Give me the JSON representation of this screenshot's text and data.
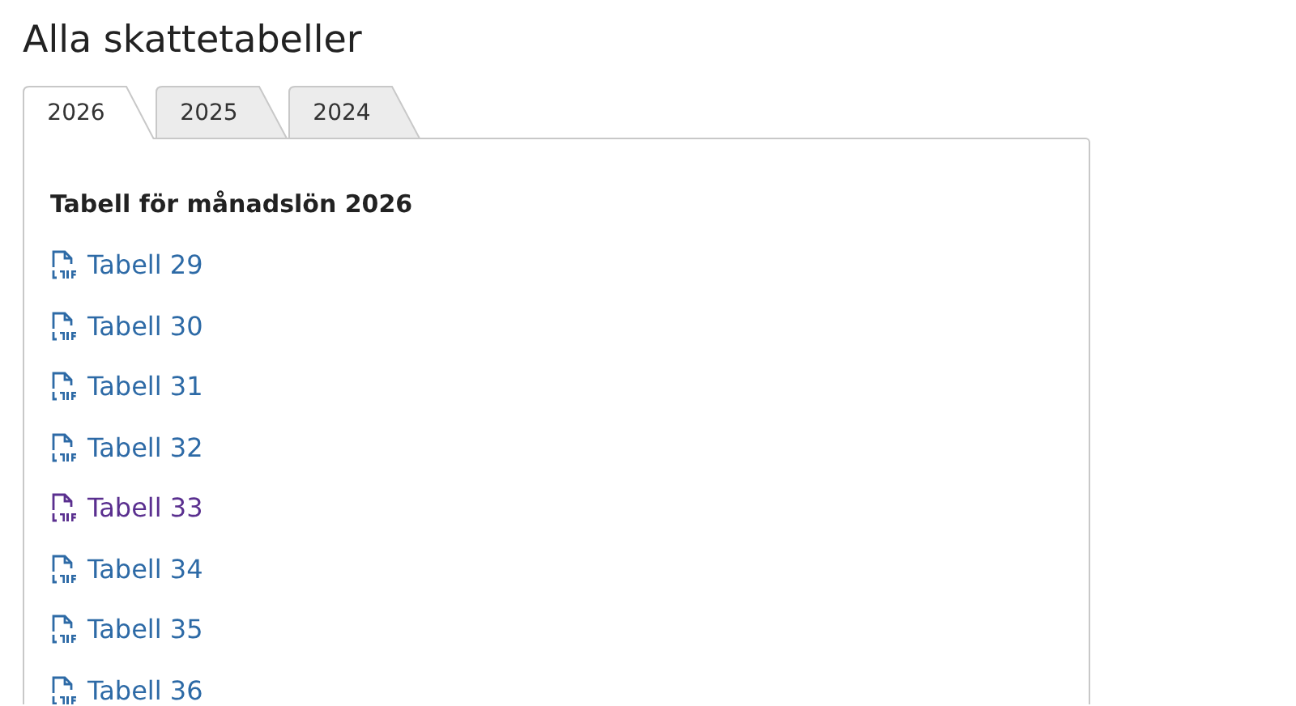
{
  "title": "Alla skattetabeller",
  "tabs": [
    {
      "label": "2026",
      "selected": true
    },
    {
      "label": "2025",
      "selected": false
    },
    {
      "label": "2024",
      "selected": false
    }
  ],
  "panel": {
    "heading": "Tabell för månadslön 2026",
    "links": [
      {
        "label": "Tabell 29",
        "visited": false
      },
      {
        "label": "Tabell 30",
        "visited": false
      },
      {
        "label": "Tabell 31",
        "visited": false
      },
      {
        "label": "Tabell 32",
        "visited": false
      },
      {
        "label": "Tabell 33",
        "visited": true
      },
      {
        "label": "Tabell 34",
        "visited": false
      },
      {
        "label": "Tabell 35",
        "visited": false
      },
      {
        "label": "Tabell 36",
        "visited": false
      }
    ]
  }
}
